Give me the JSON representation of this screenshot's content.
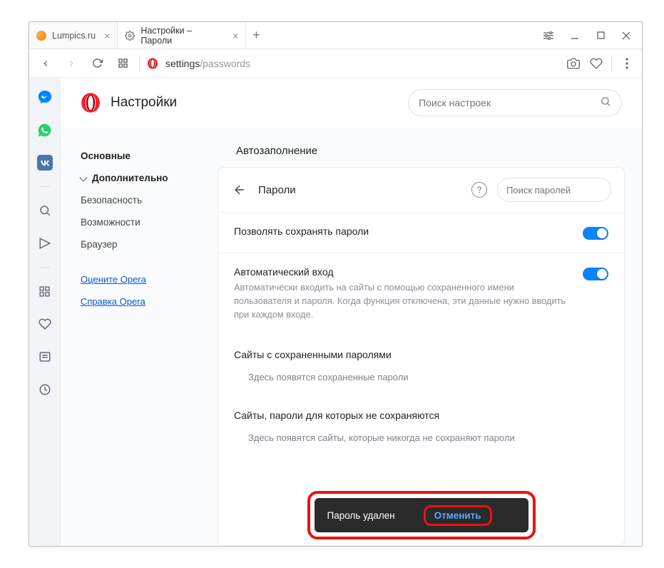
{
  "tabs": [
    {
      "title": "Lumpics.ru"
    },
    {
      "title": "Настройки – Пароли"
    }
  ],
  "address": {
    "host": "settings",
    "path": "/passwords"
  },
  "settings": {
    "title": "Настройки",
    "search_placeholder": "Поиск настроек"
  },
  "side_nav": {
    "main": "Основные",
    "advanced": "Дополнительно",
    "security": "Безопасность",
    "features": "Возможности",
    "browser": "Браузер",
    "rate": "Оцените Opera",
    "help": "Справка Opera"
  },
  "panel": {
    "section": "Автозаполнение",
    "title": "Пароли",
    "search_placeholder": "Поиск паролей",
    "allow_save": "Позволять сохранять пароли",
    "auto_login_h": "Автоматический вход",
    "auto_login_d": "Автоматически входить на сайты с помощью сохраненного имени пользователя и пароля. Когда функция отключена, эти данные нужно вводить при каждом входе.",
    "saved_h": "Сайты с сохраненными паролями",
    "saved_empty": "Здесь появятся сохраненные пароли",
    "never_h": "Сайты, пароли для которых не сохраняются",
    "never_empty": "Здесь появятся сайты, которые никогда не сохраняют пароли"
  },
  "toast": {
    "message": "Пароль удален",
    "undo": "Отменить"
  }
}
